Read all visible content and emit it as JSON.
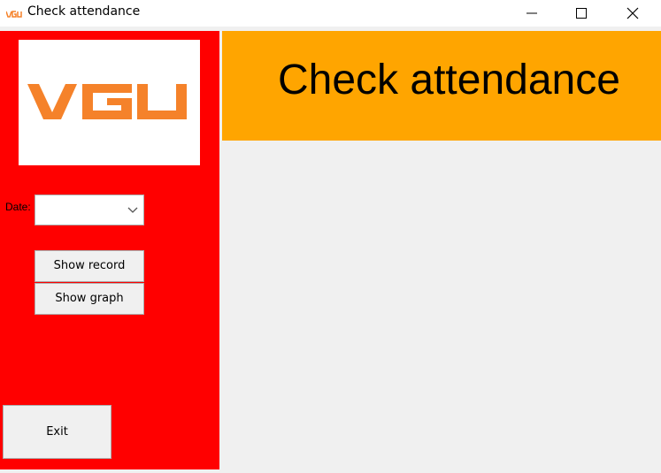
{
  "window": {
    "title": "Check attendance",
    "controls": [
      "minimize",
      "maximize",
      "close"
    ]
  },
  "sidebar": {
    "logo_text": "VGU",
    "date_label": "Date:",
    "date_value": "",
    "show_record_label": "Show record",
    "show_graph_label": "Show graph",
    "exit_label": "Exit"
  },
  "header": {
    "title": "Check attendance"
  },
  "colors": {
    "sidebar_bg": "#ff0000",
    "header_bg": "#ffa500",
    "logo_orange": "#f5822a",
    "content_bg": "#f0f0f0"
  },
  "icons": {
    "app": "vgu-logo-icon",
    "minimize": "minimize-icon",
    "maximize": "maximize-icon",
    "close": "close-icon",
    "dropdown": "chevron-down-icon"
  }
}
